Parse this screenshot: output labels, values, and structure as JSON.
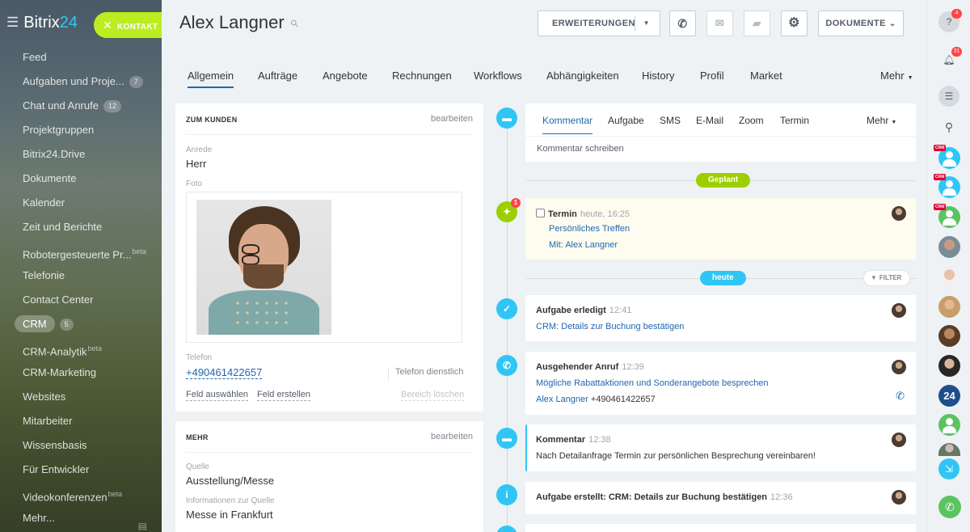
{
  "app": {
    "logo_text": "Bitrix",
    "logo_num": "24",
    "kontakt_label": "KONTAKT"
  },
  "sidebar": {
    "items": [
      {
        "label": "Feed",
        "count": "",
        "sup": ""
      },
      {
        "label": "Aufgaben und Proje...",
        "count": "7",
        "sup": ""
      },
      {
        "label": "Chat und Anrufe",
        "count": "12",
        "sup": ""
      },
      {
        "label": "Projektgruppen",
        "count": "",
        "sup": ""
      },
      {
        "label": "Bitrix24.Drive",
        "count": "",
        "sup": ""
      },
      {
        "label": "Dokumente",
        "count": "",
        "sup": ""
      },
      {
        "label": "Kalender",
        "count": "",
        "sup": ""
      },
      {
        "label": "Zeit und Berichte",
        "count": "",
        "sup": ""
      },
      {
        "label": "Robotergesteuerte Pr...",
        "count": "",
        "sup": "beta"
      },
      {
        "label": "Telefonie",
        "count": "",
        "sup": ""
      },
      {
        "label": "Contact Center",
        "count": "",
        "sup": ""
      },
      {
        "label": "CRM",
        "count": "5",
        "sup": ""
      },
      {
        "label": "CRM-Analytik",
        "count": "",
        "sup": "beta"
      },
      {
        "label": "CRM-Marketing",
        "count": "",
        "sup": ""
      },
      {
        "label": "Websites",
        "count": "",
        "sup": ""
      },
      {
        "label": "Mitarbeiter",
        "count": "",
        "sup": ""
      },
      {
        "label": "Wissensbasis",
        "count": "",
        "sup": ""
      },
      {
        "label": "Für Entwickler",
        "count": "",
        "sup": ""
      },
      {
        "label": "Videokonferenzen",
        "count": "",
        "sup": "beta"
      },
      {
        "label": "Mehr...",
        "count": "",
        "sup": ""
      }
    ]
  },
  "header": {
    "title": "Alex Langner",
    "erweiterungen": "ERWEITERUNGEN",
    "dokumente": "DOKUMENTE"
  },
  "tabs": [
    {
      "label": "Allgemein"
    },
    {
      "label": "Aufträge"
    },
    {
      "label": "Angebote"
    },
    {
      "label": "Rechnungen"
    },
    {
      "label": "Workflows"
    },
    {
      "label": "Abhängigkeiten"
    },
    {
      "label": "History"
    },
    {
      "label": "Profil"
    },
    {
      "label": "Market"
    },
    {
      "label": "Mehr"
    }
  ],
  "kunde": {
    "header": "ZUM KUNDEN",
    "edit": "bearbeiten",
    "anrede_label": "Anrede",
    "anrede_value": "Herr",
    "foto_label": "Foto",
    "telefon_label": "Telefon",
    "telefon_value": "+490461422657",
    "telefon_type": "Telefon dienstlich",
    "feld_auswaehlen": "Feld auswählen",
    "feld_erstellen": "Feld erstellen",
    "bereich_loeschen": "Bereich löschen"
  },
  "mehr": {
    "header": "MEHR",
    "edit": "bearbeiten",
    "quelle_label": "Quelle",
    "quelle_value": "Ausstellung/Messe",
    "info_label": "Informationen zur Quelle",
    "info_value": "Messe in Frankfurt"
  },
  "composer": {
    "tabs": [
      "Kommentar",
      "Aufgabe",
      "SMS",
      "E-Mail",
      "Zoom",
      "Termin",
      "Mehr"
    ],
    "placeholder": "Kommentar schreiben"
  },
  "timeline": {
    "geplant": "Geplant",
    "heute": "heute",
    "filter": "FILTER",
    "termin_badge": "1",
    "termin": {
      "title": "Termin",
      "time": "heute, 16:25",
      "subject": "Persönliches Treffen",
      "with_label": "Mit:",
      "with_name": "Alex Langner"
    },
    "aufgabe_erledigt": {
      "title": "Aufgabe erledigt",
      "time": "12:41",
      "link": "CRM: Details zur Buchung bestätigen"
    },
    "anruf": {
      "title": "Ausgehender Anruf",
      "time": "12:39",
      "link": "Mögliche Rabattaktionen und Sonderangebote besprechen",
      "name": "Alex Langner",
      "phone": "+490461422657"
    },
    "kommentar": {
      "title": "Kommentar",
      "time": "12:38",
      "text": "Nach Detailanfrage Termin zur persönlichen Besprechung vereinbaren!"
    },
    "aufgabe_erstellt": {
      "title": "Aufgabe erstellt: CRM: Details zur Buchung bestätigen",
      "time": "12:36"
    }
  },
  "rightbar": {
    "help_badge": "4",
    "bell_badge": "31",
    "crm_tag": "CRM",
    "b24_label": "24"
  }
}
